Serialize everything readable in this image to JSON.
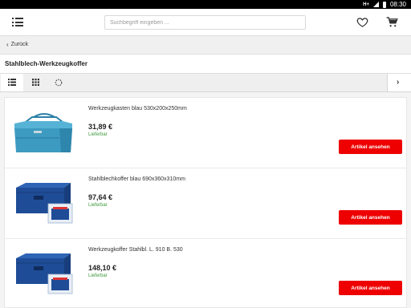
{
  "status_bar": {
    "network": "H+",
    "time": "08:30"
  },
  "header": {
    "search_placeholder": "Suchbegriff eingeben ..."
  },
  "nav": {
    "back_label": "Zurück"
  },
  "page": {
    "title": "Stahlblech-Werkzeugkoffer"
  },
  "colors": {
    "accent": "#ee0000",
    "stock": "#3a9a3a",
    "toolbox_teal": "#3d9bc1",
    "toolbox_navy": "#1f4c96"
  },
  "products": [
    {
      "name": "Werkzeugkasten blau 530x200x250mm",
      "price": "31,89 €",
      "availability": "Lieferbar",
      "button": "Artikel ansehen",
      "image": "cantilever-toolbox"
    },
    {
      "name": "Stahlblechkoffer blau 690x360x310mm",
      "price": "97,64 €",
      "availability": "Lieferbar",
      "button": "Artikel ansehen",
      "image": "steel-chest"
    },
    {
      "name": "Werkzeugkoffer Stahlbl. L. 910 B. 530",
      "price": "148,10 €",
      "availability": "Lieferbar",
      "button": "Artikel ansehen",
      "image": "steel-chest"
    }
  ]
}
